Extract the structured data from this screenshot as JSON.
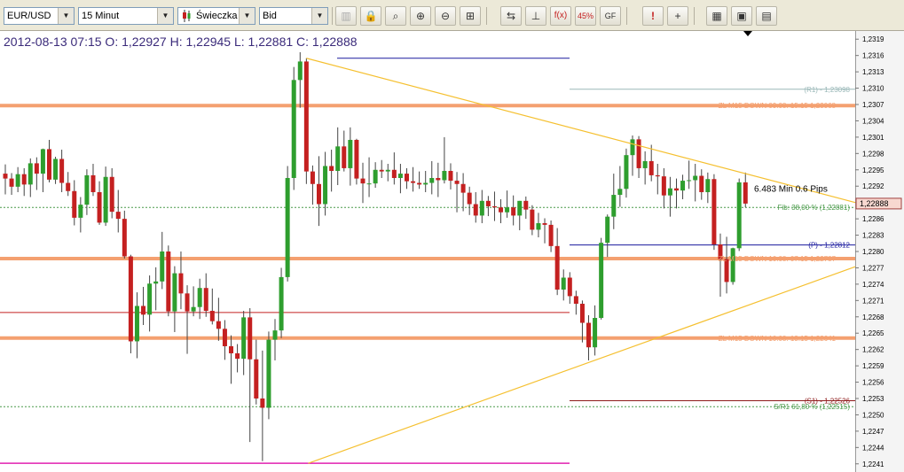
{
  "toolbar": {
    "symbol": "EUR/USD",
    "timeframe": "15 Minut",
    "chart_type": "Świeczka",
    "price_type": "Bid",
    "buttons": [
      "bar-chart-icon",
      "lock-icon",
      "zoom-icon",
      "zoom-in-icon",
      "zoom-out-icon",
      "zoom-fit-icon",
      "scroll-horizontal-icon",
      "scroll-vertical-icon",
      "function-icon",
      "fibonacci-icon",
      "gf-icon",
      "alert-icon",
      "crosshair-icon",
      "grid-icon",
      "save-icon",
      "window-icon"
    ]
  },
  "header": {
    "ohlc": "2012-08-13 07:15 O: 1,22927 H: 1,22945 L: 1,22881 C: 1,22888"
  },
  "price_axis": {
    "ticks": [
      "1,2319",
      "1,2316",
      "1,2313",
      "1,2310",
      "1,2307",
      "1,2304",
      "1,2301",
      "1,2298",
      "1,2295",
      "1,2292",
      "1,2289",
      "1,2286",
      "1,2283",
      "1,2280",
      "1,2277",
      "1,2274",
      "1,2271",
      "1,2268",
      "1,2265",
      "1,2262",
      "1,2259",
      "1,2256",
      "1,2253",
      "1,2250",
      "1,2247",
      "1,2244",
      "1,2241"
    ],
    "current_price": "1,22888"
  },
  "colors": {
    "bull": "#2e9e2e",
    "bear": "#c42020",
    "zone": "#f4a070",
    "trendline": "#f5c030",
    "pivot": "#1a1a9e",
    "resistance": "#9ab8b8",
    "support": "#8e1a1a",
    "low_line": "#e020b0",
    "current_price_bg": "#f8d8d0"
  },
  "chart_data": {
    "type": "candlestick",
    "symbol": "EUR/USD",
    "timeframe": "15 Minut",
    "ylim": [
      1.22395,
      1.23205
    ],
    "candles": [
      {
        "o": 1.22943,
        "h": 1.2296,
        "l": 1.22905,
        "c": 1.22934
      },
      {
        "o": 1.22934,
        "h": 1.22944,
        "l": 1.22904,
        "c": 1.22919
      },
      {
        "o": 1.22919,
        "h": 1.22955,
        "l": 1.22909,
        "c": 1.22942
      },
      {
        "o": 1.22942,
        "h": 1.22953,
        "l": 1.22902,
        "c": 1.22923
      },
      {
        "o": 1.22923,
        "h": 1.22971,
        "l": 1.229,
        "c": 1.22962
      },
      {
        "o": 1.22962,
        "h": 1.22973,
        "l": 1.22913,
        "c": 1.22943
      },
      {
        "o": 1.22943,
        "h": 1.22989,
        "l": 1.22909,
        "c": 1.22988
      },
      {
        "o": 1.22988,
        "h": 1.23005,
        "l": 1.22927,
        "c": 1.22932
      },
      {
        "o": 1.22932,
        "h": 1.22974,
        "l": 1.22924,
        "c": 1.2297
      },
      {
        "o": 1.2297,
        "h": 1.22987,
        "l": 1.22909,
        "c": 1.22926
      },
      {
        "o": 1.22926,
        "h": 1.22946,
        "l": 1.22902,
        "c": 1.22911
      },
      {
        "o": 1.22911,
        "h": 1.22931,
        "l": 1.22848,
        "c": 1.22862
      },
      {
        "o": 1.22862,
        "h": 1.229,
        "l": 1.22835,
        "c": 1.22886
      },
      {
        "o": 1.22886,
        "h": 1.22951,
        "l": 1.22867,
        "c": 1.2294
      },
      {
        "o": 1.2294,
        "h": 1.22961,
        "l": 1.22902,
        "c": 1.22909
      },
      {
        "o": 1.22909,
        "h": 1.22929,
        "l": 1.22849,
        "c": 1.22853
      },
      {
        "o": 1.22853,
        "h": 1.22956,
        "l": 1.22847,
        "c": 1.22937
      },
      {
        "o": 1.22937,
        "h": 1.22953,
        "l": 1.22861,
        "c": 1.22873
      },
      {
        "o": 1.22873,
        "h": 1.22913,
        "l": 1.22835,
        "c": 1.2286
      },
      {
        "o": 1.2286,
        "h": 1.22875,
        "l": 1.22787,
        "c": 1.22791
      },
      {
        "o": 1.22791,
        "h": 1.22794,
        "l": 1.22613,
        "c": 1.22635
      },
      {
        "o": 1.22635,
        "h": 1.22725,
        "l": 1.22604,
        "c": 1.227
      },
      {
        "o": 1.227,
        "h": 1.22735,
        "l": 1.22665,
        "c": 1.22684
      },
      {
        "o": 1.22684,
        "h": 1.22756,
        "l": 1.22653,
        "c": 1.22741
      },
      {
        "o": 1.22741,
        "h": 1.22771,
        "l": 1.22692,
        "c": 1.22745
      },
      {
        "o": 1.22745,
        "h": 1.22836,
        "l": 1.22731,
        "c": 1.228
      },
      {
        "o": 1.228,
        "h": 1.22811,
        "l": 1.22681,
        "c": 1.2269
      },
      {
        "o": 1.2269,
        "h": 1.22773,
        "l": 1.22652,
        "c": 1.2276
      },
      {
        "o": 1.2276,
        "h": 1.228,
        "l": 1.22694,
        "c": 1.22723
      },
      {
        "o": 1.22723,
        "h": 1.22738,
        "l": 1.22612,
        "c": 1.2269
      },
      {
        "o": 1.2269,
        "h": 1.22736,
        "l": 1.22681,
        "c": 1.22698
      },
      {
        "o": 1.22698,
        "h": 1.2275,
        "l": 1.22676,
        "c": 1.22733
      },
      {
        "o": 1.22733,
        "h": 1.2276,
        "l": 1.2268,
        "c": 1.22691
      },
      {
        "o": 1.22691,
        "h": 1.22732,
        "l": 1.22666,
        "c": 1.22672
      },
      {
        "o": 1.22672,
        "h": 1.22715,
        "l": 1.22636,
        "c": 1.22658
      },
      {
        "o": 1.22658,
        "h": 1.22674,
        "l": 1.22601,
        "c": 1.22626
      },
      {
        "o": 1.22626,
        "h": 1.22646,
        "l": 1.22557,
        "c": 1.22613
      },
      {
        "o": 1.22613,
        "h": 1.2263,
        "l": 1.22578,
        "c": 1.22603
      },
      {
        "o": 1.22603,
        "h": 1.22691,
        "l": 1.22573,
        "c": 1.22679
      },
      {
        "o": 1.22679,
        "h": 1.22696,
        "l": 1.2245,
        "c": 1.22602
      },
      {
        "o": 1.22602,
        "h": 1.22638,
        "l": 1.22519,
        "c": 1.2253
      },
      {
        "o": 1.2253,
        "h": 1.22618,
        "l": 1.22415,
        "c": 1.22513
      },
      {
        "o": 1.22513,
        "h": 1.22653,
        "l": 1.22492,
        "c": 1.22638
      },
      {
        "o": 1.22638,
        "h": 1.22676,
        "l": 1.226,
        "c": 1.22655
      },
      {
        "o": 1.22655,
        "h": 1.2277,
        "l": 1.22641,
        "c": 1.22753
      },
      {
        "o": 1.22753,
        "h": 1.22957,
        "l": 1.22745,
        "c": 1.22935
      },
      {
        "o": 1.22935,
        "h": 1.23139,
        "l": 1.22913,
        "c": 1.23115
      },
      {
        "o": 1.23115,
        "h": 1.23166,
        "l": 1.23064,
        "c": 1.23149
      },
      {
        "o": 1.23149,
        "h": 1.23155,
        "l": 1.22924,
        "c": 1.22947
      },
      {
        "o": 1.22947,
        "h": 1.22958,
        "l": 1.22886,
        "c": 1.22924
      },
      {
        "o": 1.22924,
        "h": 1.22975,
        "l": 1.22847,
        "c": 1.22887
      },
      {
        "o": 1.22887,
        "h": 1.22983,
        "l": 1.22866,
        "c": 1.22957
      },
      {
        "o": 1.22957,
        "h": 1.22987,
        "l": 1.2291,
        "c": 1.22948
      },
      {
        "o": 1.22948,
        "h": 1.23028,
        "l": 1.22922,
        "c": 1.22993
      },
      {
        "o": 1.22993,
        "h": 1.23022,
        "l": 1.22947,
        "c": 1.22953
      },
      {
        "o": 1.22953,
        "h": 1.23028,
        "l": 1.22921,
        "c": 1.23005
      },
      {
        "o": 1.23005,
        "h": 1.23007,
        "l": 1.22923,
        "c": 1.22934
      },
      {
        "o": 1.22934,
        "h": 1.22963,
        "l": 1.22889,
        "c": 1.22925
      },
      {
        "o": 1.22925,
        "h": 1.22973,
        "l": 1.229,
        "c": 1.22925
      },
      {
        "o": 1.22925,
        "h": 1.22964,
        "l": 1.22917,
        "c": 1.2295
      },
      {
        "o": 1.2295,
        "h": 1.22968,
        "l": 1.22935,
        "c": 1.22947
      },
      {
        "o": 1.22947,
        "h": 1.22961,
        "l": 1.22929,
        "c": 1.2295
      },
      {
        "o": 1.2295,
        "h": 1.22982,
        "l": 1.22923,
        "c": 1.22935
      },
      {
        "o": 1.22935,
        "h": 1.22961,
        "l": 1.22907,
        "c": 1.22943
      },
      {
        "o": 1.22943,
        "h": 1.22953,
        "l": 1.22915,
        "c": 1.22929
      },
      {
        "o": 1.22929,
        "h": 1.22955,
        "l": 1.2291,
        "c": 1.22926
      },
      {
        "o": 1.22926,
        "h": 1.22947,
        "l": 1.22915,
        "c": 1.22923
      },
      {
        "o": 1.22923,
        "h": 1.22948,
        "l": 1.22909,
        "c": 1.22926
      },
      {
        "o": 1.22926,
        "h": 1.22966,
        "l": 1.22905,
        "c": 1.22935
      },
      {
        "o": 1.22935,
        "h": 1.22963,
        "l": 1.229,
        "c": 1.22931
      },
      {
        "o": 1.22931,
        "h": 1.2301,
        "l": 1.22925,
        "c": 1.22948
      },
      {
        "o": 1.22948,
        "h": 1.22962,
        "l": 1.22914,
        "c": 1.2293
      },
      {
        "o": 1.2293,
        "h": 1.22946,
        "l": 1.22872,
        "c": 1.22924
      },
      {
        "o": 1.22924,
        "h": 1.22944,
        "l": 1.22874,
        "c": 1.22908
      },
      {
        "o": 1.22908,
        "h": 1.22919,
        "l": 1.22867,
        "c": 1.22887
      },
      {
        "o": 1.22887,
        "h": 1.22909,
        "l": 1.22853,
        "c": 1.22866
      },
      {
        "o": 1.22866,
        "h": 1.22913,
        "l": 1.22852,
        "c": 1.22893
      },
      {
        "o": 1.22893,
        "h": 1.22902,
        "l": 1.22865,
        "c": 1.22883
      },
      {
        "o": 1.22883,
        "h": 1.2291,
        "l": 1.22856,
        "c": 1.22881
      },
      {
        "o": 1.22881,
        "h": 1.22896,
        "l": 1.22852,
        "c": 1.22872
      },
      {
        "o": 1.22872,
        "h": 1.22912,
        "l": 1.22862,
        "c": 1.22881
      },
      {
        "o": 1.22881,
        "h": 1.22903,
        "l": 1.22848,
        "c": 1.22866
      },
      {
        "o": 1.22866,
        "h": 1.22893,
        "l": 1.22839,
        "c": 1.22893
      },
      {
        "o": 1.22893,
        "h": 1.22901,
        "l": 1.2286,
        "c": 1.22877
      },
      {
        "o": 1.22877,
        "h": 1.22885,
        "l": 1.2283,
        "c": 1.2284
      },
      {
        "o": 1.2284,
        "h": 1.22871,
        "l": 1.22826,
        "c": 1.22852
      },
      {
        "o": 1.22852,
        "h": 1.22861,
        "l": 1.22815,
        "c": 1.22849
      },
      {
        "o": 1.22849,
        "h": 1.22857,
        "l": 1.22799,
        "c": 1.2281
      },
      {
        "o": 1.2281,
        "h": 1.22843,
        "l": 1.2272,
        "c": 1.2273
      },
      {
        "o": 1.2273,
        "h": 1.22767,
        "l": 1.2271,
        "c": 1.22752
      },
      {
        "o": 1.22752,
        "h": 1.22762,
        "l": 1.22704,
        "c": 1.22718
      },
      {
        "o": 1.22718,
        "h": 1.22728,
        "l": 1.22684,
        "c": 1.22704
      },
      {
        "o": 1.22704,
        "h": 1.2271,
        "l": 1.22633,
        "c": 1.22669
      },
      {
        "o": 1.22669,
        "h": 1.22683,
        "l": 1.226,
        "c": 1.22624
      },
      {
        "o": 1.22624,
        "h": 1.22701,
        "l": 1.22609,
        "c": 1.22678
      },
      {
        "o": 1.22678,
        "h": 1.22825,
        "l": 1.22675,
        "c": 1.22816
      },
      {
        "o": 1.22816,
        "h": 1.22868,
        "l": 1.2279,
        "c": 1.22864
      },
      {
        "o": 1.22864,
        "h": 1.22943,
        "l": 1.22841,
        "c": 1.22904
      },
      {
        "o": 1.22904,
        "h": 1.22957,
        "l": 1.22882,
        "c": 1.22915
      },
      {
        "o": 1.22915,
        "h": 1.22989,
        "l": 1.22899,
        "c": 1.22977
      },
      {
        "o": 1.22977,
        "h": 1.23013,
        "l": 1.22939,
        "c": 1.23006
      },
      {
        "o": 1.23006,
        "h": 1.23012,
        "l": 1.22935,
        "c": 1.22953
      },
      {
        "o": 1.22953,
        "h": 1.22984,
        "l": 1.22923,
        "c": 1.22966
      },
      {
        "o": 1.22966,
        "h": 1.22996,
        "l": 1.22929,
        "c": 1.2294
      },
      {
        "o": 1.2294,
        "h": 1.22961,
        "l": 1.22905,
        "c": 1.22938
      },
      {
        "o": 1.22938,
        "h": 1.22953,
        "l": 1.22879,
        "c": 1.22903
      },
      {
        "o": 1.22903,
        "h": 1.22937,
        "l": 1.22864,
        "c": 1.22916
      },
      {
        "o": 1.22916,
        "h": 1.22934,
        "l": 1.22879,
        "c": 1.22912
      },
      {
        "o": 1.22912,
        "h": 1.22941,
        "l": 1.22896,
        "c": 1.2293
      },
      {
        "o": 1.2293,
        "h": 1.22967,
        "l": 1.22915,
        "c": 1.22931
      },
      {
        "o": 1.22931,
        "h": 1.22961,
        "l": 1.22892,
        "c": 1.22939
      },
      {
        "o": 1.22939,
        "h": 1.22951,
        "l": 1.22895,
        "c": 1.22909
      },
      {
        "o": 1.22909,
        "h": 1.22945,
        "l": 1.22889,
        "c": 1.22933
      },
      {
        "o": 1.22933,
        "h": 1.22942,
        "l": 1.22803,
        "c": 1.22813
      },
      {
        "o": 1.22813,
        "h": 1.22833,
        "l": 1.22717,
        "c": 1.22786
      },
      {
        "o": 1.22786,
        "h": 1.22827,
        "l": 1.22723,
        "c": 1.22744
      },
      {
        "o": 1.22744,
        "h": 1.22807,
        "l": 1.22739,
        "c": 1.22806
      },
      {
        "o": 1.22806,
        "h": 1.22934,
        "l": 1.22801,
        "c": 1.22927
      },
      {
        "o": 1.22927,
        "h": 1.22945,
        "l": 1.22881,
        "c": 1.22888
      }
    ],
    "horizontal_lines": [
      {
        "label": "(R1) - 1,23098",
        "price": 1.23098,
        "type": "resistance"
      },
      {
        "label": "ZL M15 DOWN 09.08. 15:15   1,23068",
        "price": 1.23068,
        "type": "zone"
      },
      {
        "label": "Fib: 38,00 % (1,22881)",
        "price": 1.22881,
        "type": "fib"
      },
      {
        "label": "(P) - 1,22812",
        "price": 1.22812,
        "type": "pivot"
      },
      {
        "label": "ZL M15 DOWN 10.08. 07:15   1,22787",
        "price": 1.22787,
        "type": "zone"
      },
      {
        "label": "ZL M15 DOWN 10.08. 13:15   1,22641",
        "price": 1.22641,
        "type": "zone"
      },
      {
        "label": "(S1) - 1,22526",
        "price": 1.22526,
        "type": "support"
      },
      {
        "label": "S/R1 61,80 % (1,22515)",
        "price": 1.22515,
        "type": "fib"
      }
    ],
    "annotations": [
      "6.483 Min 0.6 Pips"
    ]
  }
}
